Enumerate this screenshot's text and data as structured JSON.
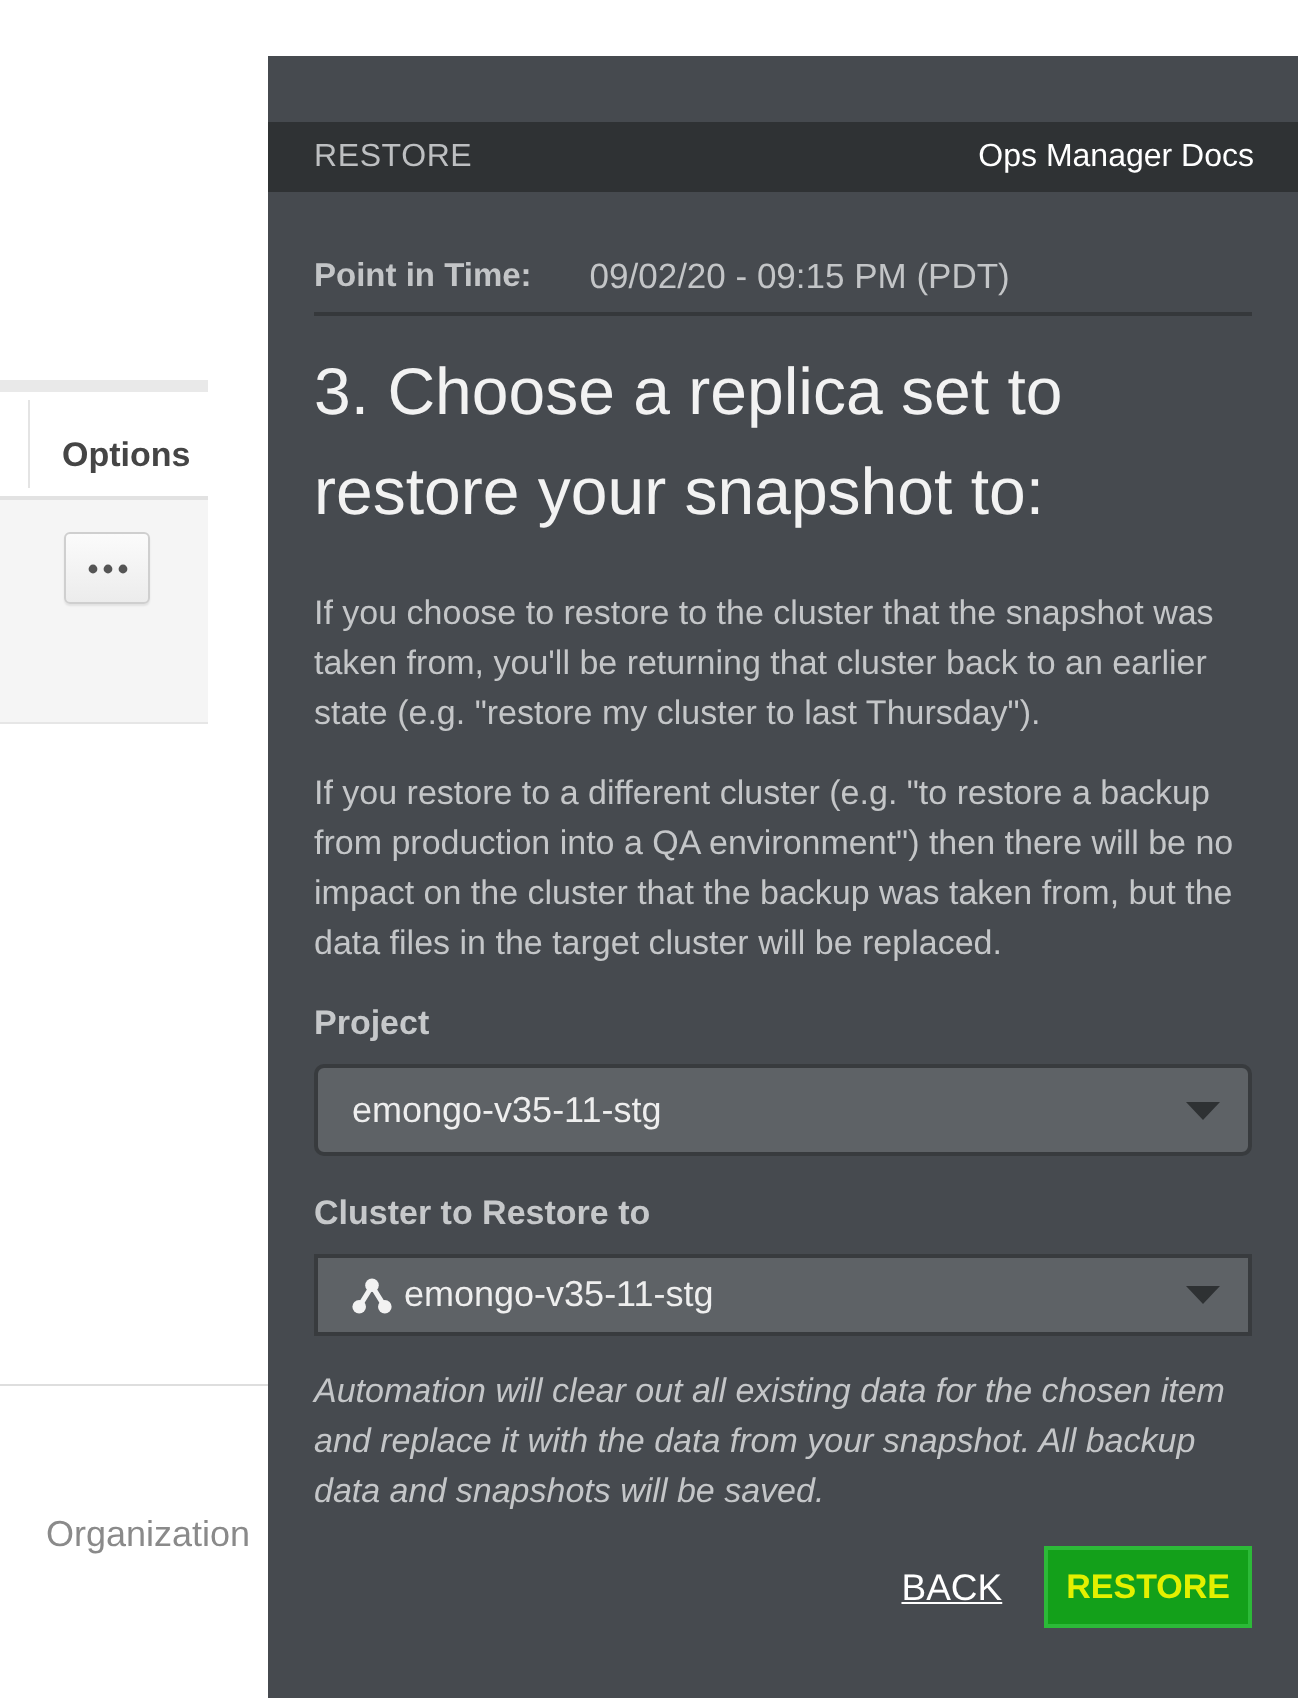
{
  "background": {
    "table": {
      "columns": [
        {
          "label": "Options"
        }
      ],
      "rows": [
        {
          "kind": "more"
        }
      ]
    },
    "footer": {
      "link": "Organization"
    }
  },
  "panel": {
    "header": {
      "title": "RESTORE",
      "docs_link": "Ops Manager Docs"
    },
    "point_in_time": {
      "label": "Point in Time:",
      "value": "09/02/20 - 09:15 PM (PDT)"
    },
    "heading": "3. Choose a replica set to restore your snapshot to:",
    "paragraphs": [
      "If you choose to restore to the cluster that the snapshot was taken from, you'll be returning that cluster back to an earlier state (e.g. \"restore my cluster to last Thursday\").",
      "If you restore to a different cluster (e.g. \"to restore a backup from production into a QA environment\") then there will be no impact on the cluster that the backup was taken from, but the data files in the target cluster will be replaced."
    ],
    "fields": [
      {
        "label": "Project",
        "value": "emongo-v35-11-stg",
        "kind": "plain"
      },
      {
        "label": "Cluster to Restore to",
        "value": "emongo-v35-11-stg",
        "kind": "cluster"
      }
    ],
    "note": "Automation will clear out all existing data for the chosen item and replace it with the data from your snapshot. All backup data and snapshots will be saved.",
    "buttons": [
      {
        "label": "BACK",
        "kind": "link"
      },
      {
        "label": "RESTORE",
        "kind": "primary"
      }
    ]
  }
}
